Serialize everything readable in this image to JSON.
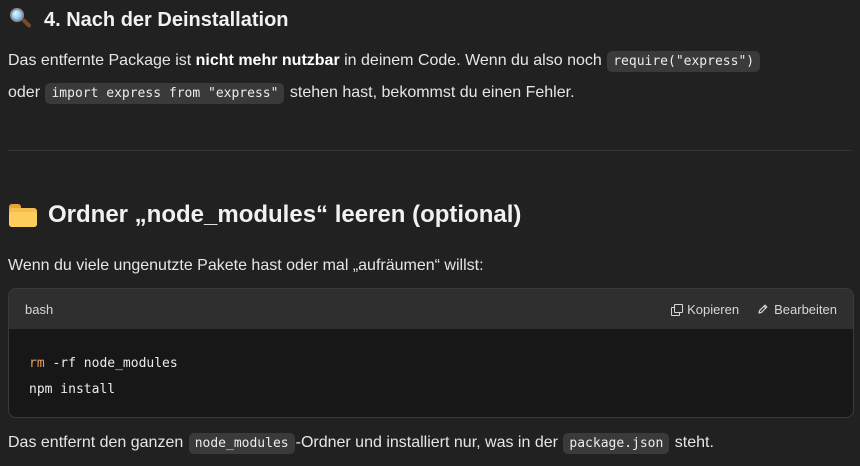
{
  "section4": {
    "emoji_icon": "magnifying-glass-icon",
    "title": "4. Nach der Deinstallation",
    "para1": {
      "t1": "Das entfernte Package ist ",
      "bold": "nicht mehr nutzbar",
      "t2": " in deinem Code. Wenn du also noch ",
      "code1": "require(\"express\")",
      "t3": "oder ",
      "code2": "import express from \"express\"",
      "t4": " stehen hast, bekommst du einen Fehler."
    }
  },
  "section5": {
    "emoji_icon": "folder-icon",
    "title": "Ordner „node_modules“ leeren (optional)",
    "intro": "Wenn du viele ungenutzte Pakete hast oder mal „aufräumen“ willst:",
    "codeblock": {
      "language": "bash",
      "copy_label": "Kopieren",
      "edit_label": "Bearbeiten",
      "line1_cmd": "rm",
      "line1_rest": " -rf node_modules",
      "line2": "npm install"
    },
    "outro": {
      "t1": "Das entfernt den ganzen ",
      "code1": "node_modules",
      "t2": "-Ordner und installiert nur, was in der ",
      "code2": "package.json",
      "t3": " steht."
    }
  },
  "colors": {
    "background": "#212121",
    "code_keyword": "#e8a15c",
    "inline_code_bg": "#3a3a3a"
  }
}
